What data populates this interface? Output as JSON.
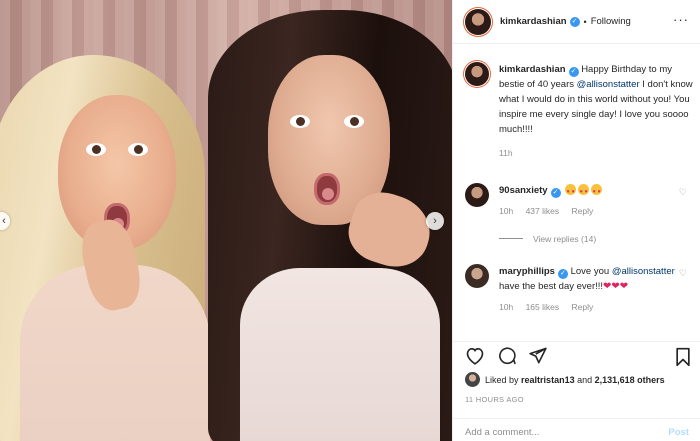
{
  "photo": {
    "alt_icons": {
      "prev": "chevron-left-icon",
      "next": "chevron-right-icon"
    },
    "prev_glyph": "‹",
    "next_glyph": "›"
  },
  "header": {
    "username": "kimkardashian",
    "separator": "•",
    "follow_status": "Following",
    "more_glyph": "···"
  },
  "caption": {
    "username": "kimkardashian",
    "text_before_mention": "Happy Birthday to my bestie of 40 years ",
    "mention": "@allisonstatter",
    "text_after_mention": " I don't know what I would do in this world without you! You inspire me every single day! I love you soooo much!!!!",
    "time": "11h"
  },
  "comments": [
    {
      "username": "90sanxiety",
      "verified": true,
      "emoji_count": 3,
      "time": "10h",
      "likes": "437 likes",
      "reply": "Reply"
    },
    {
      "username": "maryphillips",
      "verified": true,
      "text_before_mention": "Love you ",
      "mention": "@allisonstatter",
      "text_after_mention": " have the best day ever!!!",
      "hearts": "❤❤❤",
      "time": "10h",
      "likes": "165 likes",
      "reply": "Reply"
    }
  ],
  "view_replies": "View replies (14)",
  "actions": {
    "like_icon": "heart-icon",
    "comment_icon": "comment-icon",
    "share_icon": "paper-plane-icon",
    "save_icon": "bookmark-icon"
  },
  "likes": {
    "prefix": "Liked by ",
    "user": "realtristan13",
    "middle": " and ",
    "count": "2,131,618 others"
  },
  "timestamp": "11 HOURS AGO",
  "add_comment": {
    "placeholder": "Add a comment...",
    "post_label": "Post"
  },
  "colors": {
    "link": "#00376b",
    "verified": "#3897f0",
    "muted": "#8e8e8e",
    "post_disabled": "#b2dffc"
  }
}
